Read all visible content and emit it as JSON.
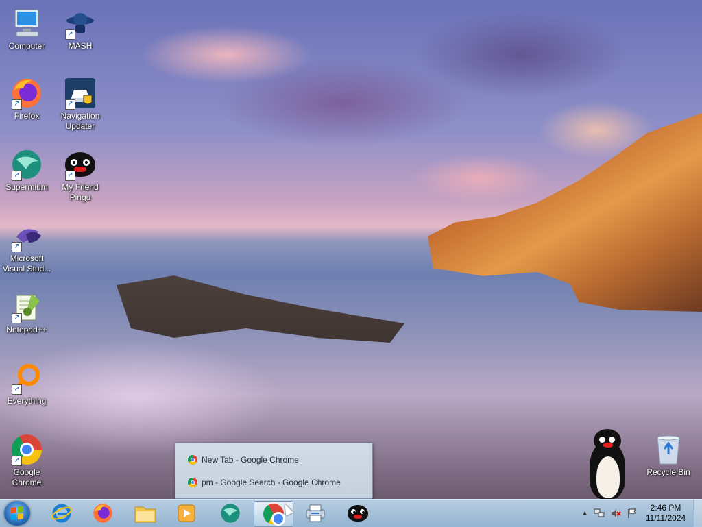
{
  "desktop": {
    "icons": [
      {
        "label": "Computer"
      },
      {
        "label": "MASH"
      },
      {
        "label": "Firefox"
      },
      {
        "label": "Navigation Updater"
      },
      {
        "label": "Supermium"
      },
      {
        "label": "My Friend Pingu"
      },
      {
        "label": "Microsoft Visual Stud..."
      },
      {
        "label": "Notepad++"
      },
      {
        "label": "Everything"
      },
      {
        "label": "Google Chrome"
      },
      {
        "label": "Recycle Bin"
      }
    ]
  },
  "jumplist": {
    "items": [
      {
        "label": "New Tab - Google Chrome"
      },
      {
        "label": "pm - Google Search - Google Chrome"
      }
    ]
  },
  "taskbar": {
    "pinned": [
      "internet-explorer-icon",
      "firefox-icon",
      "file-explorer-icon",
      "media-player-icon",
      "supermium-icon",
      "chrome-icon",
      "printer-app-icon",
      "pingu-icon"
    ],
    "active": "chrome-icon"
  },
  "tray": {
    "time": "2:46 PM",
    "date": "11/11/2024"
  },
  "colors": {
    "taskbar": "#a9c6de",
    "popup": "#d4dee8"
  }
}
